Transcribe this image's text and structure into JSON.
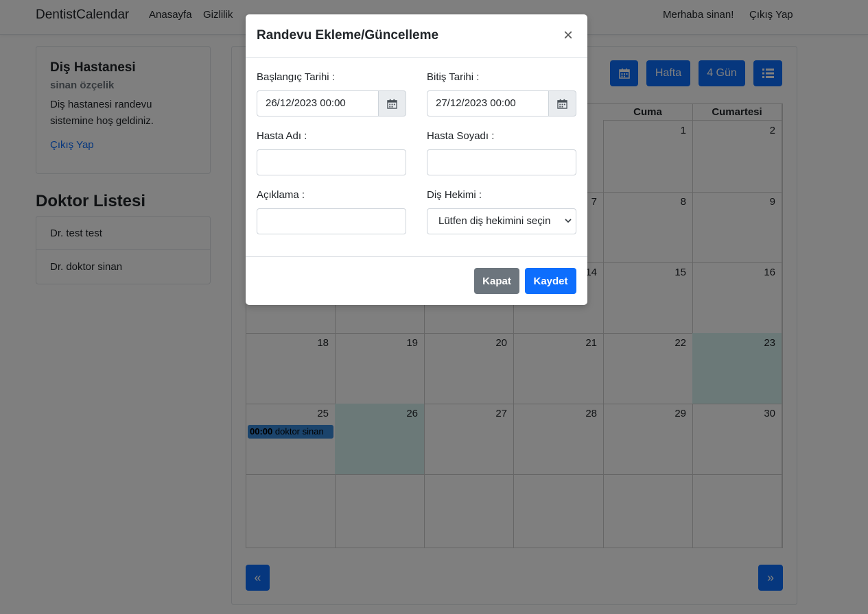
{
  "navbar": {
    "brand": "DentistCalendar",
    "home": "Anasayfa",
    "privacy": "Gizlilik",
    "greeting": "Merhaba sinan!",
    "logout": "Çıkış Yap"
  },
  "sidebar": {
    "card_title": "Diş Hastanesi",
    "card_subtitle": "sinan özçelik",
    "card_text": "Diş hastanesi randevu sistemine hoş geldiniz.",
    "card_link": "Çıkış Yap",
    "doctors_title": "Doktor Listesi",
    "doctors": [
      "Dr. test test",
      "Dr. doktor sinan"
    ]
  },
  "calendar": {
    "toolbar": {
      "week": "Hafta",
      "four_day": "4 Gün"
    },
    "visible_headers": [
      "Cuma",
      "Cumartesi"
    ],
    "weeks": [
      [
        "",
        "",
        "",
        "",
        "1",
        "2"
      ],
      [
        "",
        "",
        "",
        "7",
        "8",
        "9"
      ],
      [
        "",
        "",
        "",
        "14",
        "15",
        "16"
      ],
      [
        "18",
        "19",
        "20",
        "21",
        "22",
        "23"
      ],
      [
        "25",
        "26",
        "27",
        "28",
        "29",
        "30"
      ],
      [
        "",
        "",
        "",
        "",
        "",
        ""
      ]
    ],
    "event": {
      "time": "00:00",
      "title": "doktor sinan"
    },
    "prev": "«",
    "next": "»"
  },
  "modal": {
    "title": "Randevu Ekleme/Güncelleme",
    "close": "×",
    "start_label": "Başlangıç Tarihi :",
    "start_value": "26/12/2023 00:00",
    "end_label": "Bitiş Tarihi :",
    "end_value": "27/12/2023 00:00",
    "patient_name_label": "Hasta Adı :",
    "patient_surname_label": "Hasta Soyadı :",
    "description_label": "Açıklama :",
    "dentist_label": "Diş Hekimi :",
    "dentist_placeholder": "Lütfen diş hekimini seçin",
    "close_button": "Kapat",
    "save_button": "Kaydet"
  }
}
